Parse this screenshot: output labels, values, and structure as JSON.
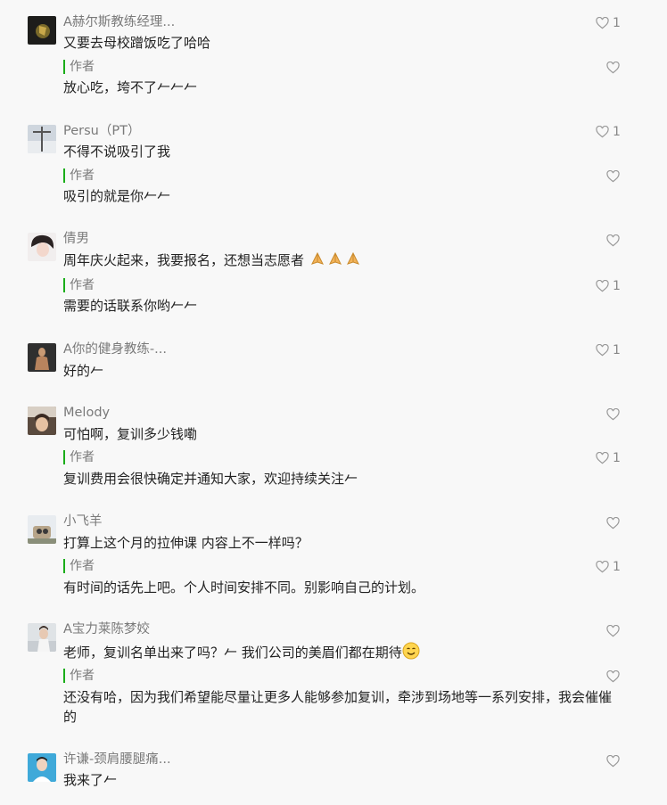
{
  "author_label": "作者",
  "comments": [
    {
      "nickname": "A赫尔斯教练经理...",
      "content": "又要去母校蹭饭吃了哈哈",
      "likes": "1",
      "reply": {
        "content": "放心吃，垮不了𠂉𠂉𠂉",
        "likes": ""
      }
    },
    {
      "nickname": "Persu（PT）",
      "content": "不得不说吸引了我",
      "likes": "1",
      "reply": {
        "content": "吸引的就是你𠂉𠂉",
        "likes": ""
      }
    },
    {
      "nickname": "倩男",
      "content": "周年庆火起来，我要报名，还想当志愿者",
      "likes": "",
      "reply": {
        "content": "需要的话联系你哟𠂉𠂉",
        "likes": "1"
      }
    },
    {
      "nickname": "A你的健身教练-...",
      "content": "好的𠂉",
      "likes": "1"
    },
    {
      "nickname": "Melody",
      "content": "可怕啊，复训多少钱嘞",
      "likes": "",
      "reply": {
        "content": "复训费用会很快确定并通知大家，欢迎持续关注𠂉",
        "likes": "1"
      }
    },
    {
      "nickname": "小飞羊",
      "content": "打算上这个月的拉伸课 内容上不一样吗？",
      "likes": "",
      "reply": {
        "content": "有时间的话先上吧。个人时间安排不同。别影响自己的计划。",
        "likes": "1"
      }
    },
    {
      "nickname": "A宝力莱陈梦姣",
      "content": "老师，复训名单出来了吗？𠂉 我们公司的美眉们都在期待",
      "likes": "",
      "reply": {
        "content": "还没有哈，因为我们希望能尽量让更多人能够参加复训，牵涉到场地等一系列安排，我会催催的",
        "likes": ""
      }
    },
    {
      "nickname": "许谦-颈肩腰腿痛...",
      "content": "我来了𠂉",
      "likes": ""
    }
  ],
  "icons": {
    "like": "heart-outline-icon",
    "emoji_hands": "pray-hands-icon",
    "emoji_smile": "smile-icon"
  },
  "colors": {
    "author_bar": "#1aad19",
    "background": "#f8f8f8"
  }
}
